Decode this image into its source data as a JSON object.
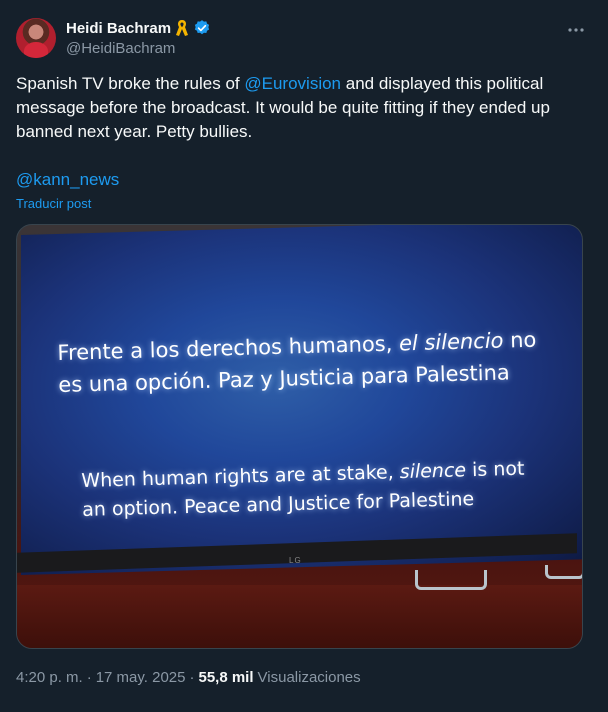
{
  "author": {
    "display_name": "Heidi Bachram",
    "handle": "@HeidiBachram",
    "badge_icon": "yellow-ribbon-icon",
    "verified_icon": "verified-badge-icon",
    "verified_color": "#1d9bf0"
  },
  "more_icon": "more-horizontal-icon",
  "tweet": {
    "text_before": "Spanish TV broke the rules of ",
    "mention": "@Eurovision",
    "text_after": " and displayed this political message before the broadcast. It would be quite fitting if they ended up banned next year. Petty bullies.",
    "link_mention": "@kann_news",
    "translate_label": "Traducir post"
  },
  "media": {
    "tv_logo": "LG",
    "es_line1_a": "Frente a los derechos humanos, ",
    "es_line1_b": "el silencio",
    "es_line1_c": " no",
    "es_line2": "es una opción. Paz y Justicia para Palestina",
    "en_line1_a": "When human rights are at stake, ",
    "en_line1_b": "silence",
    "en_line1_c": " is not",
    "en_line2": "an option. Peace and Justice for Palestine"
  },
  "meta": {
    "time": "4:20 p. m.",
    "separator1": "·",
    "date": "17 may. 2025",
    "separator2": "·",
    "views_count": "55,8 mil",
    "views_label": "Visualizaciones"
  },
  "colors": {
    "background": "#15202b",
    "text": "#f7f9f9",
    "secondary": "#8b98a5",
    "accent": "#1d9bf0"
  }
}
